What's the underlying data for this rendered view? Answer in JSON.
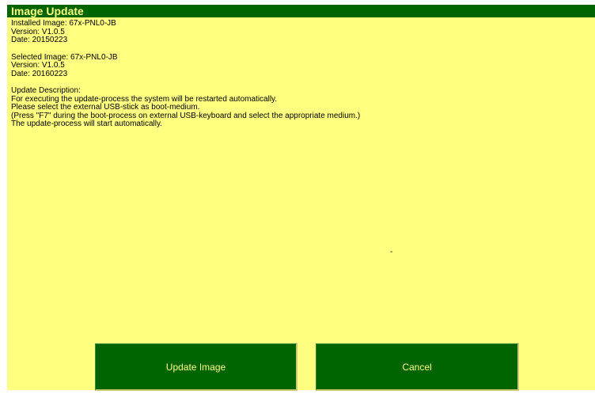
{
  "window": {
    "title": "Image Update"
  },
  "installed": {
    "image": "Installed Image: 67x-PNL0-JB",
    "version": "Version: V1.0.5",
    "date": "Date: 20150223"
  },
  "selected": {
    "image": "Selected Image: 67x-PNL0-JB",
    "version": "Version: V1.0.5",
    "date": "Date: 20160223"
  },
  "description": {
    "heading": "Update Description:",
    "line1": "For executing the update-process the system will be restarted automatically.",
    "line2": "Please select the external USB-stick as boot-medium.",
    "line3": "(Press \"F7\" during the boot-process on external USB-keyboard and select the appropriate medium.)",
    "line4": "The update-process will start automatically."
  },
  "marker": "-",
  "buttons": {
    "update_label": "Update Image",
    "cancel_label": "Cancel"
  },
  "colors": {
    "panel_background": "#ffff80",
    "accent_green": "#006400",
    "title_text": "#ffff80"
  }
}
